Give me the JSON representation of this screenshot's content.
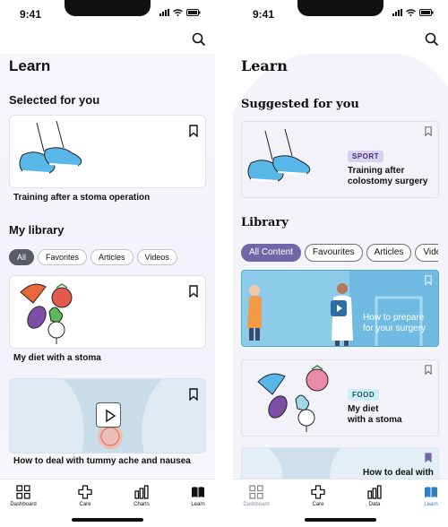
{
  "status_time": "9:41",
  "screen_a": {
    "title": "Learn",
    "selected_header": "Selected for you",
    "selected_caption": "Training after a stoma operation",
    "library_header": "My library",
    "filters": [
      "All",
      "Favorites",
      "Articles",
      "Videos"
    ],
    "items": [
      {
        "caption": "My diet with a stoma"
      },
      {
        "caption": "How to deal with tummy ache and nausea"
      }
    ],
    "tabs": [
      {
        "label": "Dashboard",
        "icon": "grid-icon"
      },
      {
        "label": "Care",
        "icon": "cross-icon"
      },
      {
        "label": "Charts",
        "icon": "bar-chart-icon"
      },
      {
        "label": "Learn",
        "icon": "book-icon"
      }
    ]
  },
  "screen_b": {
    "title": "Learn",
    "suggested_header": "Suggested for you",
    "suggested_tag": "SPORT",
    "suggested_title_l1": "Training after",
    "suggested_title_l2": "colostomy surgery",
    "library_header": "Library",
    "filters": [
      "All Content",
      "Favourites",
      "Articles",
      "Video"
    ],
    "video_title_l1": "How to prepare",
    "video_title_l2": "for your surgery",
    "food_tag": "FOOD",
    "food_title_l1": "My diet",
    "food_title_l2": "with a stoma",
    "partial_title": "How to deal with",
    "tabs": [
      {
        "label": "Dashboard",
        "icon": "grid-icon"
      },
      {
        "label": "Care",
        "icon": "cross-icon"
      },
      {
        "label": "Data",
        "icon": "bar-chart-icon"
      },
      {
        "label": "Learn",
        "icon": "book-icon"
      }
    ]
  },
  "colors": {
    "accent_b": "#6e68a8",
    "active_tab_b": "#2f7fc7",
    "sport_tag_bg": "#d9d1f2",
    "food_tag_bg": "#cfeef3"
  }
}
